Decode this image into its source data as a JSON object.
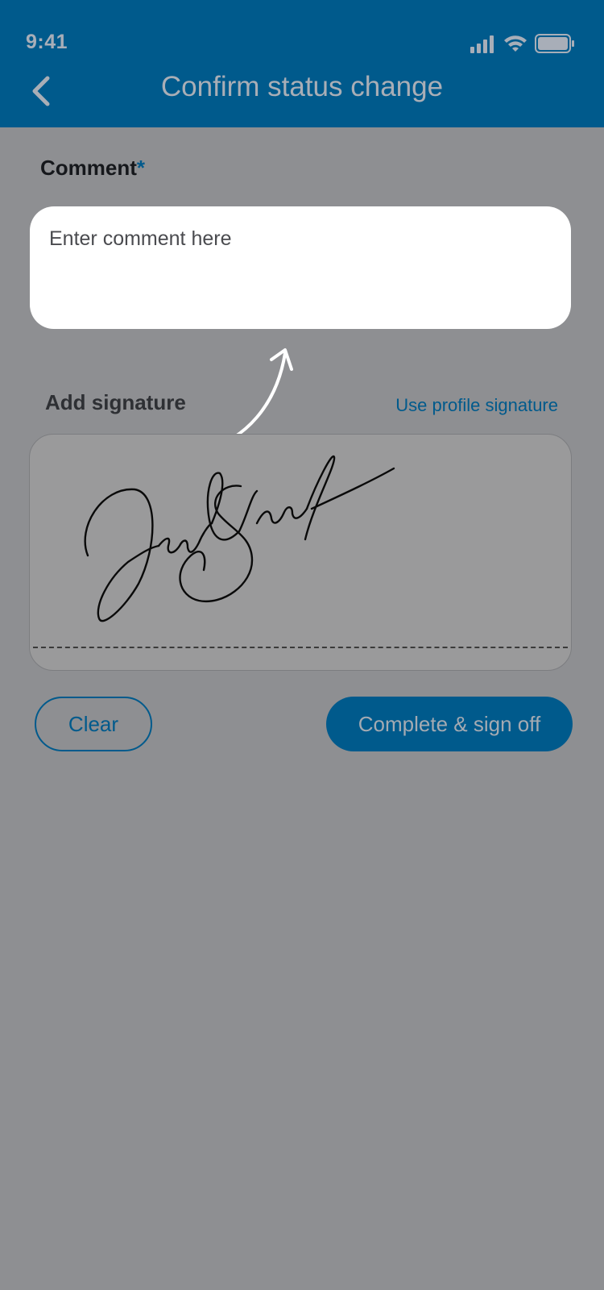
{
  "status_bar": {
    "time": "9:41",
    "icons": [
      "cellular-signal-icon",
      "wifi-icon",
      "battery-icon"
    ]
  },
  "header": {
    "title": "Confirm status change",
    "back_icon": "chevron-left-icon"
  },
  "comment": {
    "label": "Comment",
    "required_marker": "*",
    "placeholder": "Enter comment here"
  },
  "signature": {
    "label": "Add signature",
    "use_profile_label": "Use profile signature",
    "hint_icon": "curved-arrow-up-icon"
  },
  "actions": {
    "clear_label": "Clear",
    "complete_label": "Complete & sign off"
  },
  "colors": {
    "brand": "#005a8c",
    "overlay": "#8e8f92",
    "input_background": "#ffffff"
  }
}
